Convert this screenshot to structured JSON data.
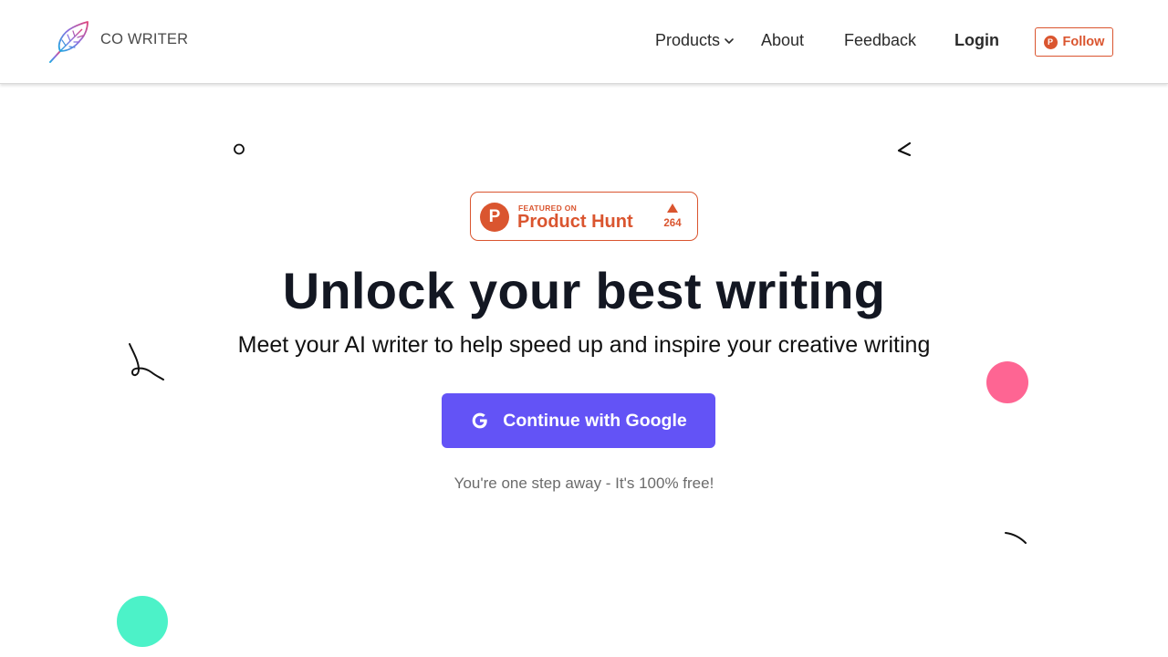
{
  "header": {
    "brand_name": "CO WRITER",
    "nav": {
      "products": "Products",
      "about": "About",
      "feedback": "Feedback",
      "login": "Login"
    },
    "follow_label": "Follow"
  },
  "badge": {
    "featured_on": "FEATURED ON",
    "title": "Product Hunt",
    "votes": "264"
  },
  "hero": {
    "title": "Unlock your best writing",
    "subtitle": "Meet your AI writer to help speed up and inspire your creative writing",
    "cta_label": "Continue with Google",
    "note": "You're one step away - It's 100% free!"
  },
  "icons": {
    "logo": "feather-quill-icon",
    "products_caret": "chevron-down-icon",
    "follow": "product-hunt-icon",
    "cta": "google-icon"
  },
  "colors": {
    "accent": "#6353f6",
    "product_hunt": "#da552f",
    "pink_dot": "#fe6593",
    "teal_dot": "#4cf2c8",
    "title_text": "#131722"
  }
}
